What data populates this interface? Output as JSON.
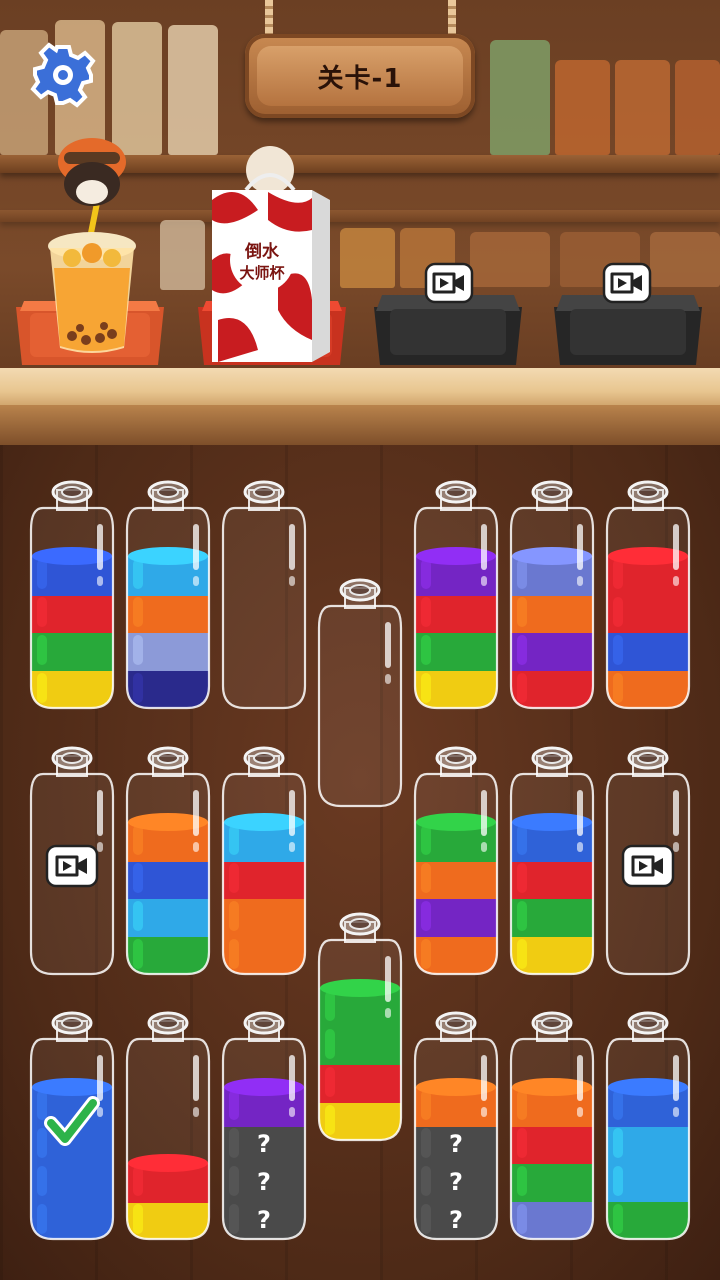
{
  "level": {
    "label": "关卡-1"
  },
  "icons": {
    "settings": "gear-icon",
    "video": "video-play-icon",
    "check": "checkmark-icon",
    "hidden": "question-mark"
  },
  "trays": [
    {
      "name": "drink-tray",
      "color": "#ef6a3a",
      "content": "bubble-tea",
      "locked": false
    },
    {
      "name": "bag-tray",
      "color": "#e04a35",
      "content": "gift-bag",
      "bag_text": [
        "倒水",
        "大师杯"
      ],
      "locked": false
    },
    {
      "name": "locked-tray-1",
      "color": "#3a3a3a",
      "content": "empty",
      "locked": true
    },
    {
      "name": "locked-tray-2",
      "color": "#3a3a3a",
      "content": "empty",
      "locked": true
    }
  ],
  "colors": {
    "blue": "#2f55d6",
    "red": "#e0242c",
    "green": "#28a93a",
    "yellow": "#f0cc12",
    "cyan": "#2fa9e8",
    "orange": "#ef6b1e",
    "periwinkle": "#8c9ad8",
    "navy": "#2a2a8c",
    "purple": "#7425c4",
    "slate": "#6a78d0",
    "royal": "#2f62d8",
    "hidden": "#4a4a4a"
  },
  "bottles": [
    {
      "id": "b1",
      "layers": [
        "yellow",
        "green",
        "red",
        "blue"
      ]
    },
    {
      "id": "b2",
      "layers": [
        "navy",
        "periwinkle",
        "orange",
        "cyan"
      ]
    },
    {
      "id": "b3",
      "layers": []
    },
    {
      "id": "b4",
      "layers": []
    },
    {
      "id": "b5",
      "layers": [
        "yellow",
        "green",
        "red",
        "purple"
      ]
    },
    {
      "id": "b6",
      "layers": [
        "red",
        "purple",
        "orange",
        "slate"
      ]
    },
    {
      "id": "b7",
      "layers": [
        "orange",
        "blue",
        "red",
        "red"
      ]
    },
    {
      "id": "b8",
      "layers": [],
      "locked": true
    },
    {
      "id": "b9",
      "layers": [
        "green",
        "cyan",
        "blue",
        "orange"
      ]
    },
    {
      "id": "b10",
      "layers": [
        "orange",
        "orange",
        "red",
        "cyan"
      ]
    },
    {
      "id": "b11",
      "layers": [
        "orange",
        "purple",
        "orange",
        "green"
      ]
    },
    {
      "id": "b12",
      "layers": [
        "yellow",
        "green",
        "red",
        "royal"
      ]
    },
    {
      "id": "b13",
      "layers": [],
      "locked": true
    },
    {
      "id": "b14",
      "layers": [
        "yellow",
        "red",
        "green",
        "green"
      ]
    },
    {
      "id": "b15",
      "layers": [
        "royal",
        "royal",
        "royal",
        "royal"
      ],
      "complete": true
    },
    {
      "id": "b16",
      "layers": [
        "yellow",
        "red"
      ]
    },
    {
      "id": "b17",
      "layers": [
        "hidden",
        "hidden",
        "hidden",
        "purple"
      ],
      "hidden_marks": [
        "?",
        "?",
        "?"
      ]
    },
    {
      "id": "b18",
      "layers": [
        "hidden",
        "hidden",
        "hidden",
        "orange"
      ],
      "hidden_marks": [
        "?",
        "?",
        "?"
      ]
    },
    {
      "id": "b19",
      "layers": [
        "slate",
        "green",
        "red",
        "orange"
      ]
    },
    {
      "id": "b20",
      "layers": [
        "green",
        "cyan",
        "cyan",
        "royal"
      ]
    }
  ]
}
